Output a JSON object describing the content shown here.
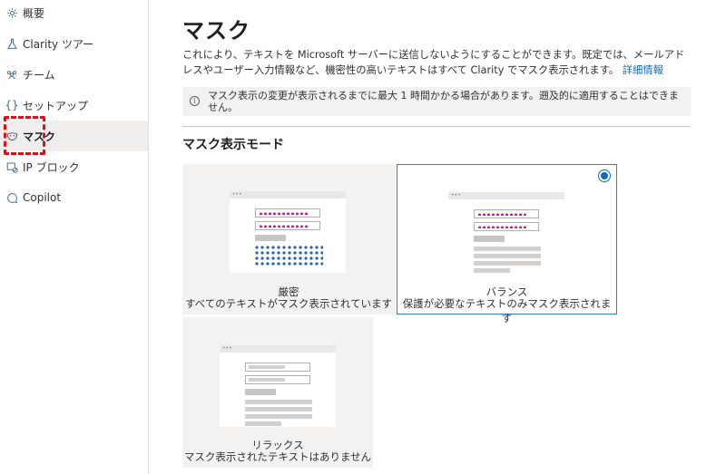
{
  "sidebar": {
    "items": [
      {
        "label": "概要",
        "icon": "gear-icon"
      },
      {
        "label": "Clarity ツアー",
        "icon": "flask-icon"
      },
      {
        "label": "チーム",
        "icon": "people-icon"
      },
      {
        "label": "セットアップ",
        "icon": "braces-icon"
      },
      {
        "label": "マスク",
        "icon": "mask-icon"
      },
      {
        "label": "IP ブロック",
        "icon": "ip-block-icon"
      },
      {
        "label": "Copilot",
        "icon": "chat-icon"
      }
    ],
    "active_index": 4
  },
  "main": {
    "title": "マスク",
    "description": "これにより、テキストを Microsoft サーバーに送信しないようにすることができます。既定では、メールアドレスやユーザー入力情報など、機密性の高いテキストはすべて Clarity でマスク表示されます。",
    "learn_more": "詳細情報",
    "notice": "マスク表示の変更が表示されるまでに最大 1 時間かかる場合があります。遡及的に適用することはできません。",
    "section_title": "マスク表示モード",
    "modes": [
      {
        "name": "厳密",
        "description": "すべてのテキストがマスク表示されています",
        "selected": false
      },
      {
        "name": "バランス",
        "description": "保護が必要なテキストのみマスク表示されます",
        "selected": true
      },
      {
        "name": "リラックス",
        "description": "マスク表示されたテキストはありません",
        "selected": false
      }
    ]
  },
  "colors": {
    "accent": "#0f6cbd",
    "highlight": "#e0101a",
    "masked_pink": "#c8198a",
    "masked_blue": "#2461b5"
  }
}
